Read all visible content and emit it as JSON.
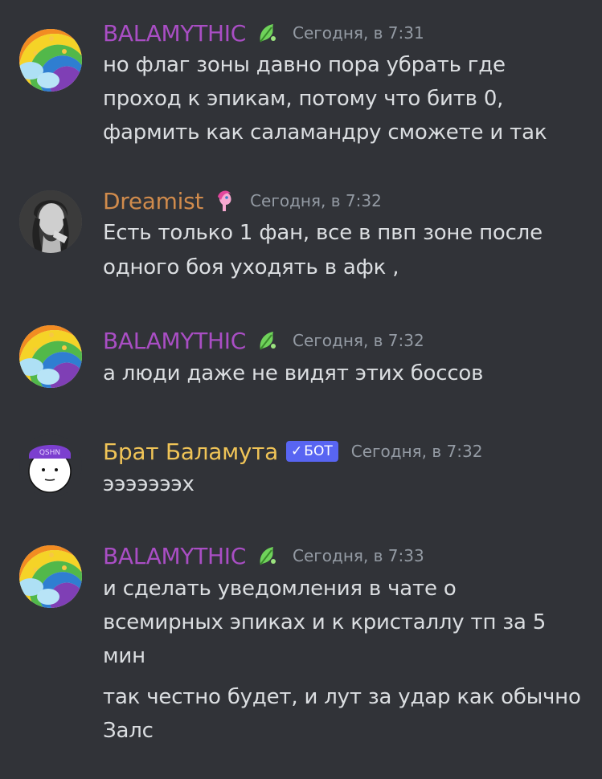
{
  "messages": [
    {
      "author": "BALAMYTHIC",
      "author_color": "#a94ec4",
      "timestamp": "Сегодня, в 7:31",
      "badge_icon": "green-leaf-icon",
      "lines": [
        "но флаг зоны давно пора убрать где",
        "проход к эпикам, потому что битв 0,",
        "фармить как саламандру сможете и так"
      ]
    },
    {
      "author": "Dreamist",
      "author_color": "#d08b4c",
      "timestamp": "Сегодня, в 7:32",
      "badge_icon": "pink-pony-icon",
      "lines": [
        "Есть только 1 фан, все в пвп зоне после",
        "одного боя уходять в афк ,"
      ]
    },
    {
      "author": "BALAMYTHIC",
      "author_color": "#a94ec4",
      "timestamp": "Сегодня, в 7:32",
      "badge_icon": "green-leaf-icon",
      "lines": [
        "а люди даже не видят этих боссов"
      ]
    },
    {
      "author": "Брат Баламута",
      "author_color": "#f0c457",
      "timestamp": "Сегодня, в 7:32",
      "bot_tag": "БОТ",
      "bot_check": "✓",
      "lines": [
        "эээээээх"
      ]
    },
    {
      "author": "BALAMYTHIC",
      "author_color": "#a94ec4",
      "timestamp": "Сегодня, в 7:33",
      "badge_icon": "green-leaf-icon",
      "lines": [
        "и сделать уведомления в чате о",
        "всемирных эпиках и к кристаллу тп за 5",
        "мин",
        "так честно будет, и лут за удар как обычно",
        "Залс"
      ]
    }
  ],
  "avatar_labels": {
    "bot_cap": "QSHN"
  }
}
